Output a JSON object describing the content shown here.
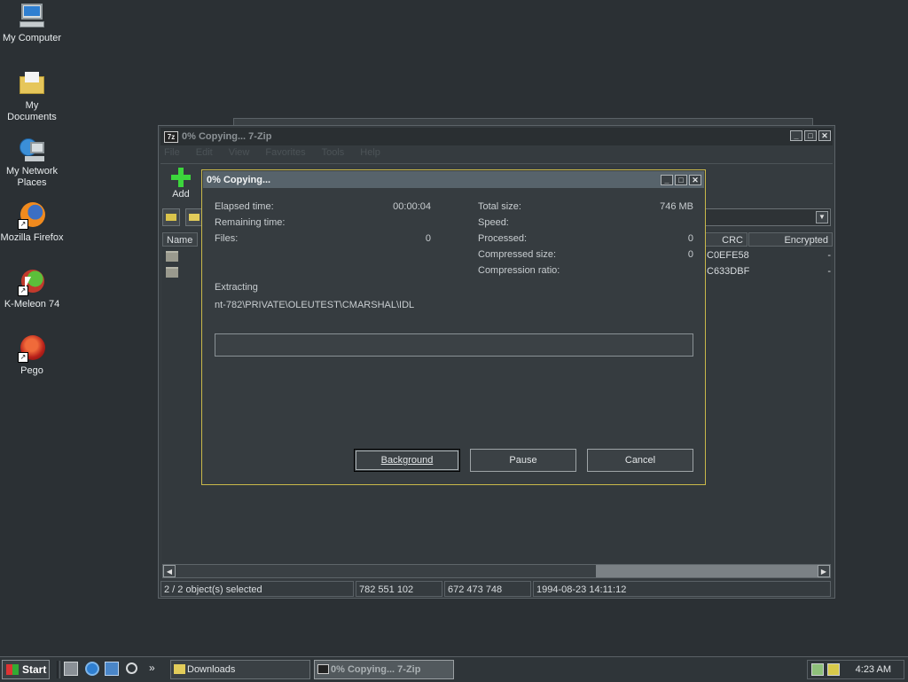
{
  "desktop": {
    "icons": [
      {
        "label": "My Computer"
      },
      {
        "label": "My Documents"
      },
      {
        "label": "My Network Places"
      },
      {
        "label": "Mozilla Firefox"
      },
      {
        "label": "K-Meleon 74"
      },
      {
        "label": "Pego"
      }
    ]
  },
  "main_window": {
    "title": "0% Copying... 7-Zip",
    "app_icon_text": "7z",
    "menu": [
      "File",
      "Edit",
      "View",
      "Favorites",
      "Tools",
      "Help"
    ],
    "toolbar": {
      "add_label": "Add"
    },
    "columns": {
      "name": "Name",
      "crc": "CRC",
      "encrypted": "Encrypted"
    },
    "rows": [
      {
        "crc": "C0EFE58",
        "encrypted": "-"
      },
      {
        "crc": "C633DBF",
        "encrypted": "-"
      }
    ],
    "status": {
      "selected": "2 / 2 object(s) selected",
      "size": "782 551 102",
      "packed": "672 473 748",
      "modified": "1994-08-23 14:11:12"
    }
  },
  "dialog": {
    "title": "0% Copying...",
    "elapsed_label": "Elapsed time:",
    "elapsed_value": "00:00:04",
    "remaining_label": "Remaining time:",
    "files_label": "Files:",
    "files_value": "0",
    "total_size_label": "Total size:",
    "total_size_value": "746 MB",
    "speed_label": "Speed:",
    "processed_label": "Processed:",
    "processed_value": "0",
    "compressed_label": "Compressed size:",
    "compressed_value": "0",
    "ratio_label": "Compression ratio:",
    "action": "Extracting",
    "path": "nt-782\\PRIVATE\\OLEUTEST\\CMARSHAL\\IDL",
    "progress_percent": 0,
    "buttons": {
      "background": "Background",
      "pause": "Pause",
      "cancel": "Cancel"
    }
  },
  "taskbar": {
    "start_label": "Start",
    "overflow": "»",
    "items": [
      {
        "label": "Downloads"
      },
      {
        "label": "0% Copying... 7-Zip"
      }
    ],
    "clock": "4:23 AM"
  },
  "colors": {
    "desktop": "#2b3034",
    "dialog_border": "#c9b84a",
    "dialog_title": "#57636b",
    "add_icon": "#3cd63c"
  }
}
